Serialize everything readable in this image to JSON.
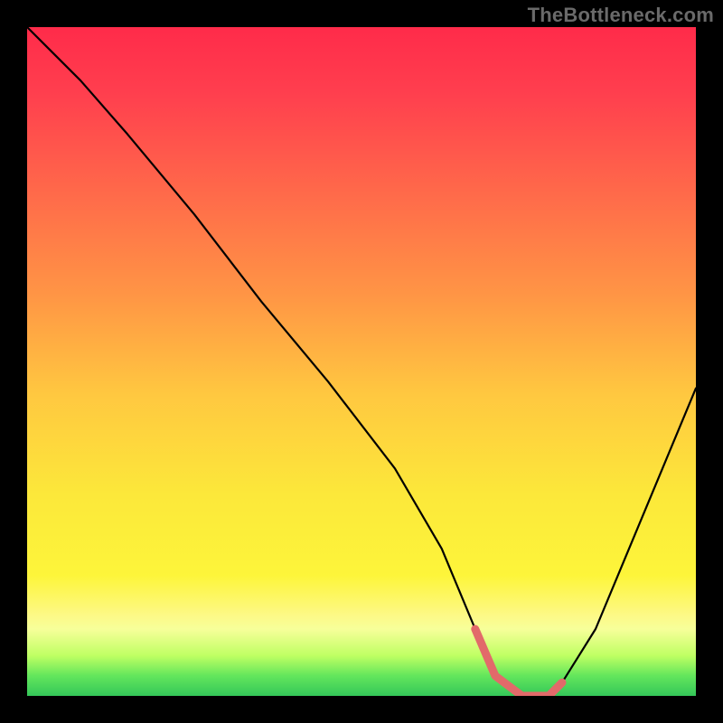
{
  "watermark": "TheBottleneck.com",
  "chart_data": {
    "type": "line",
    "title": "",
    "xlabel": "",
    "ylabel": "",
    "xlim": [
      0,
      100
    ],
    "ylim": [
      0,
      100
    ],
    "series": [
      {
        "name": "bottleneck-curve",
        "x": [
          0,
          3,
          8,
          15,
          25,
          35,
          45,
          55,
          62,
          67,
          70,
          74,
          78,
          80,
          85,
          90,
          95,
          100
        ],
        "y": [
          100,
          97,
          92,
          84,
          72,
          59,
          47,
          34,
          22,
          10,
          3,
          0,
          0,
          2,
          10,
          22,
          34,
          46
        ]
      }
    ],
    "highlight_segment": {
      "name": "minimum-plateau",
      "x": [
        67,
        70,
        74,
        78,
        80
      ],
      "y": [
        10,
        3,
        0,
        0,
        2
      ],
      "color": "#e26a6a"
    },
    "gradient_stops": [
      {
        "pos": 0,
        "color": "#ff2b4a"
      },
      {
        "pos": 25,
        "color": "#ff6a4a"
      },
      {
        "pos": 55,
        "color": "#ffc840"
      },
      {
        "pos": 82,
        "color": "#fdf53a"
      },
      {
        "pos": 100,
        "color": "#34c759"
      }
    ]
  }
}
